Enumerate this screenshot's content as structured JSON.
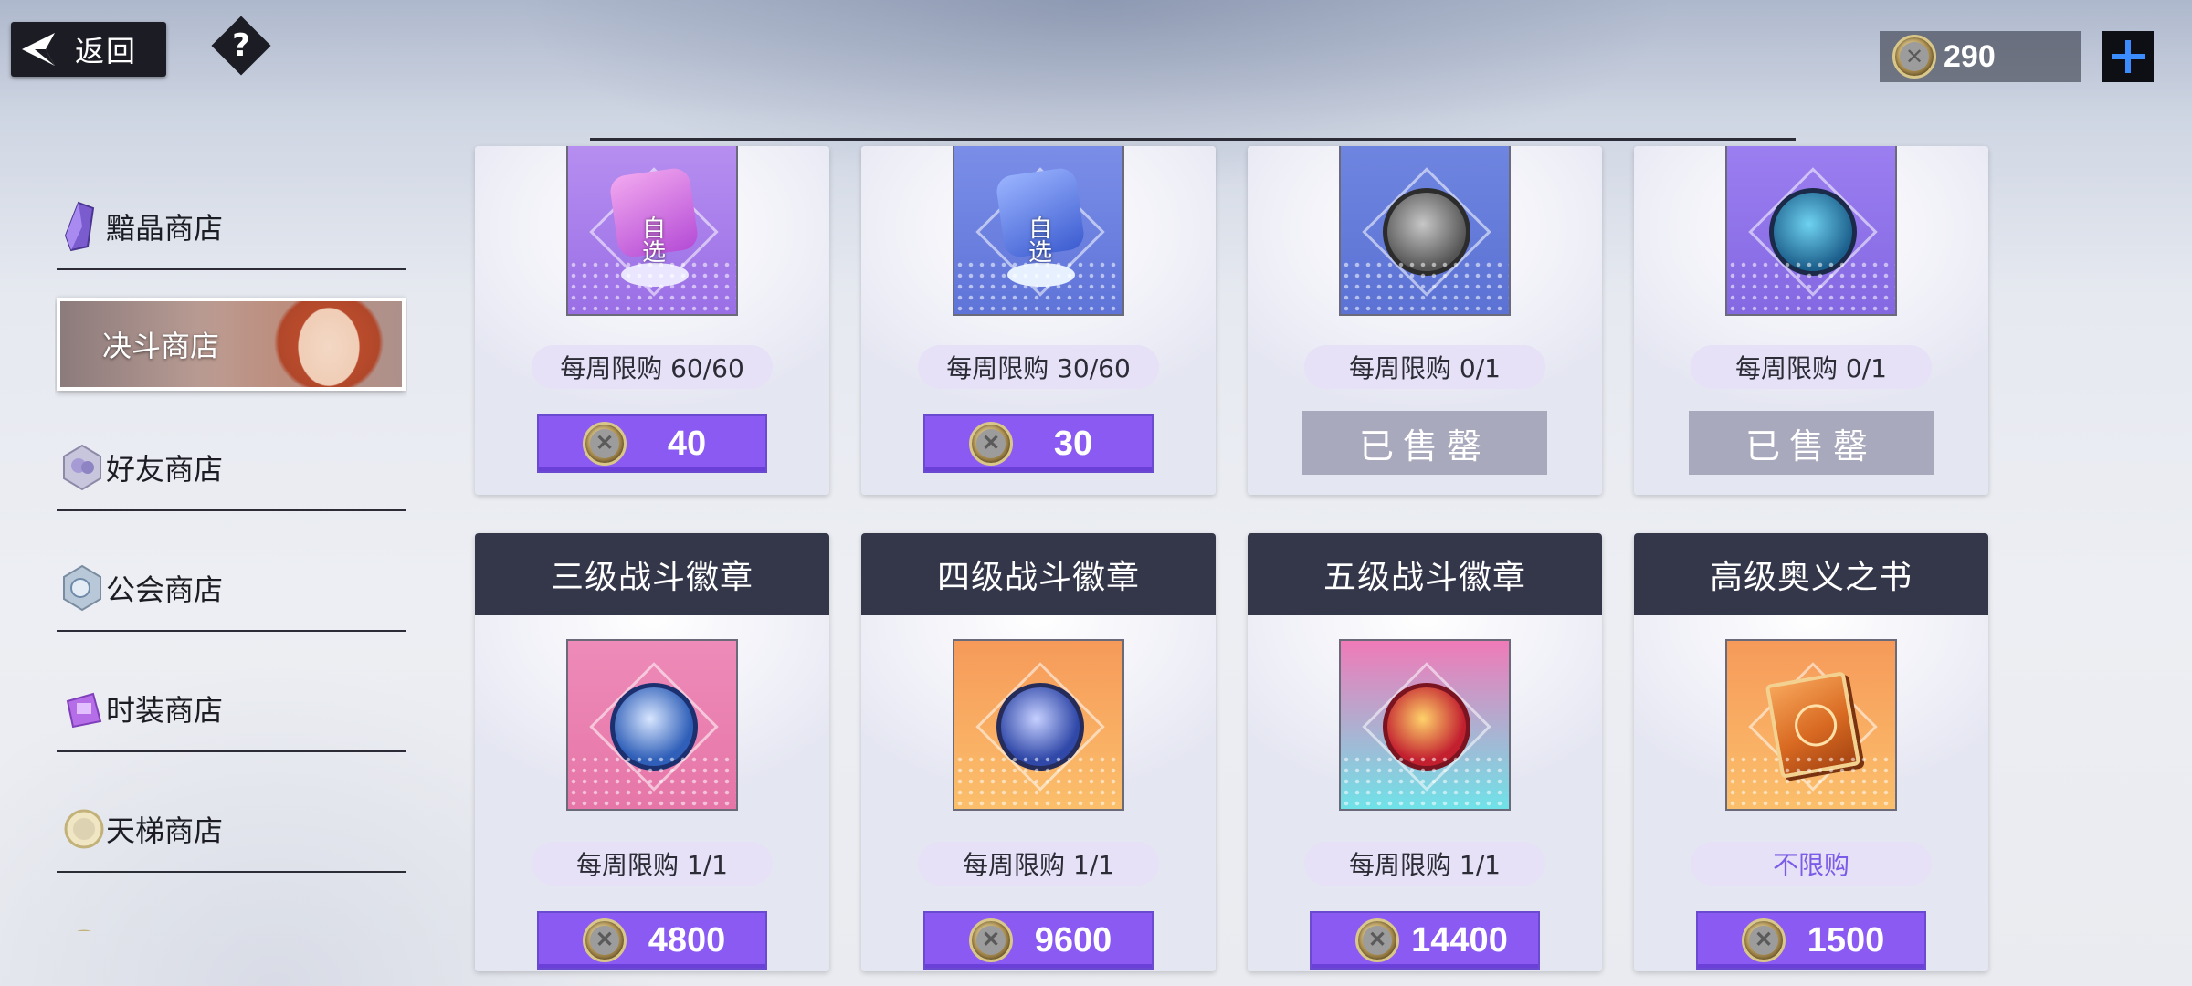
{
  "top_bar": {
    "back_label": "返回",
    "help_label": "?",
    "currency_value": "290"
  },
  "sidebar": {
    "items": [
      {
        "label": "黯晶商店",
        "icon": "crystal-icon",
        "active": false
      },
      {
        "label": "决斗商店",
        "icon": "duel-banner",
        "active": true
      },
      {
        "label": "好友商店",
        "icon": "friend-icon",
        "active": false
      },
      {
        "label": "公会商店",
        "icon": "guild-icon",
        "active": false
      },
      {
        "label": "时装商店",
        "icon": "fashion-icon",
        "active": false
      },
      {
        "label": "天梯商店",
        "icon": "ladder-icon",
        "active": false
      },
      {
        "label": "…",
        "icon": "partial-icon",
        "active": false
      }
    ]
  },
  "shop": {
    "row1": [
      {
        "limit": "每周限购 60/60",
        "price": "40",
        "sold_out": false,
        "icon": "puzzle-select-icon",
        "icon_text": "自\n选"
      },
      {
        "limit": "每周限购 30/60",
        "price": "30",
        "sold_out": false,
        "icon": "puzzle-select-icon",
        "icon_text": "自\n选"
      },
      {
        "limit": "每周限购 0/1",
        "sold_out_label": "已售罄",
        "sold_out": true,
        "icon": "silver-badge-icon"
      },
      {
        "limit": "每周限购 0/1",
        "sold_out_label": "已售罄",
        "sold_out": true,
        "icon": "blue-badge-icon"
      }
    ],
    "row2": [
      {
        "title": "三级战斗徽章",
        "limit": "每周限购 1/1",
        "price": "4800",
        "icon": "badge-level3-icon"
      },
      {
        "title": "四级战斗徽章",
        "limit": "每周限购 1/1",
        "price": "9600",
        "icon": "badge-level4-icon"
      },
      {
        "title": "五级战斗徽章",
        "limit": "每周限购 1/1",
        "price": "14400",
        "icon": "badge-level5-icon"
      },
      {
        "title": "高级奥义之书",
        "limit": "不限购",
        "price": "1500",
        "icon": "secret-book-icon"
      }
    ]
  },
  "colors": {
    "price_button": "#8a5af2",
    "sold_out_button": "#a9a9bd",
    "title_bar": "#34364a",
    "limit_pill": "#e6e1f6",
    "accent_plus": "#3b8cff"
  }
}
